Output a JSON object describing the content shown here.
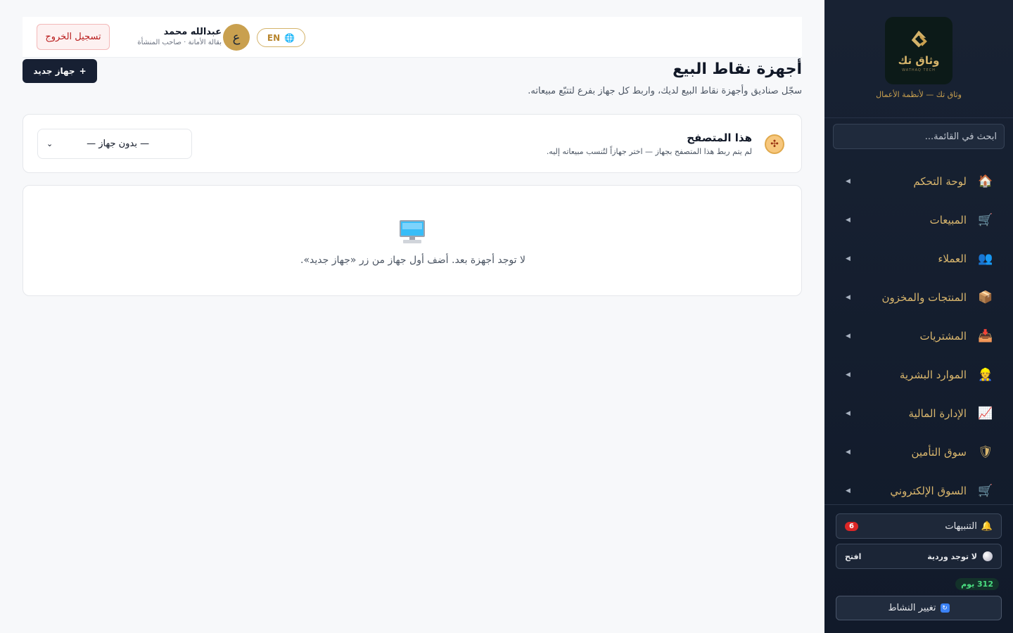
{
  "sidebar": {
    "logo_text": "وثاق تك",
    "logo_sub": "WATHAQ TECH",
    "tagline": "وثاق تك — لأنظمة الأعمال",
    "search_placeholder": "ابحث في القائمة...",
    "items": [
      {
        "label": "لوحة التحكم",
        "icon": "house-icon",
        "glyph": "🏠"
      },
      {
        "label": "المبيعات",
        "icon": "cart-icon",
        "glyph": "🛒"
      },
      {
        "label": "العملاء",
        "icon": "users-icon",
        "glyph": "👥"
      },
      {
        "label": "المنتجات والمخزون",
        "icon": "box-icon",
        "glyph": "📦"
      },
      {
        "label": "المشتريات",
        "icon": "inbox-icon",
        "glyph": "📥"
      },
      {
        "label": "الموارد البشرية",
        "icon": "person-icon",
        "glyph": "👷"
      },
      {
        "label": "الإدارة المالية",
        "icon": "chart-icon",
        "glyph": "📈"
      },
      {
        "label": "سوق التأمين",
        "icon": "shield-icon",
        "glyph": "🛡"
      },
      {
        "label": "السوق الإلكتروني",
        "icon": "cart-icon",
        "glyph": "🛒"
      }
    ],
    "notifications_label": "التنبيهات",
    "notifications_count": "6",
    "shift_label": "لا توجد وردية",
    "shift_action": "افتح",
    "days_left": "312 يوم",
    "switch_label": "تغيير النشاط"
  },
  "header": {
    "lang_label": "EN",
    "avatar_letter": "ع",
    "user_name": "عبدالله محمد",
    "user_role": "بقالة الأمانة · صاحب المنشأة",
    "logout_label": "تسجيل الخروج"
  },
  "page": {
    "title": "أجهزة نقاط البيع",
    "subtitle": "سجّل صناديق وأجهزة نقاط البيع لديك، واربط كل جهاز بفرع لتتبّع مبيعاته.",
    "new_device_label": "جهاز جديد"
  },
  "browser_card": {
    "title": "هذا المتصفح",
    "description": "لم يتم ربط هذا المتصفح بجهاز — اختر جهازاً لتُنسب مبيعاته إليه.",
    "select_value": "— بدون جهاز —"
  },
  "empty_state": {
    "text": "لا توجد أجهزة بعد. أضف أول جهاز من زر «جهاز جديد»."
  },
  "colors": {
    "sidebar_bg": "#182233",
    "accent_gold": "#d4b36a",
    "primary_dark": "#172033",
    "danger": "#b91c1c"
  }
}
